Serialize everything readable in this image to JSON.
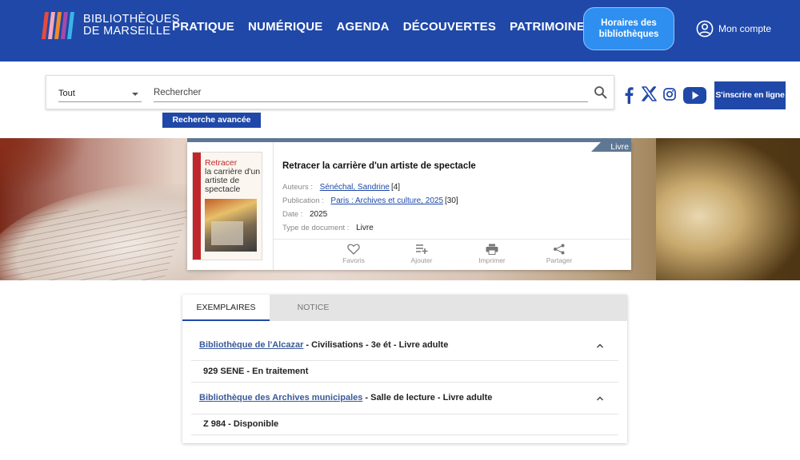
{
  "header": {
    "logo_line1": "BIBLIOTHÈQUES",
    "logo_line2": "DE MARSEILLE",
    "nav": [
      "PRATIQUE",
      "NUMÉRIQUE",
      "AGENDA",
      "DÉCOUVERTES",
      "PATRIMOINE"
    ],
    "hours_button": "Horaires des bibliothèques",
    "account_label": "Mon compte",
    "colors": {
      "brand": "#1f48a8",
      "accent": "#2e8ff0"
    }
  },
  "search": {
    "scope_value": "Tout",
    "placeholder": "Rechercher",
    "advanced_label": "Recherche avancée",
    "social_icons": [
      "facebook-icon",
      "x-icon",
      "instagram-icon",
      "youtube-icon"
    ],
    "signup_label": "S'inscrire en ligne"
  },
  "record": {
    "type_badge": "Livre",
    "cover_title_first": "Retracer",
    "cover_title_rest": "la carrière d'un artiste de spectacle",
    "title": "Retracer la carrière d'un artiste de spectacle",
    "authors_label": "Auteurs :",
    "authors_value": "Sénéchal, Sandrine",
    "authors_count": "[4]",
    "publication_label": "Publication :",
    "publication_value": "Paris : Archives et culture, 2025",
    "publication_count": "[30]",
    "date_label": "Date :",
    "date_value": "2025",
    "doctype_label": "Type de document :",
    "doctype_value": "Livre",
    "actions": [
      "Favoris",
      "Ajouter",
      "Imprimer",
      "Partager"
    ]
  },
  "copies": {
    "tabs": [
      "EXEMPLAIRES",
      "NOTICE"
    ],
    "items": [
      {
        "library": "Bibliothèque de l'Alcazar",
        "location": " - Civilisations - 3e ét - Livre adulte",
        "holding": "929 SENE - En traitement"
      },
      {
        "library": "Bibliothèque des Archives municipales",
        "location": " - Salle de lecture - Livre adulte",
        "holding": "Z 984 - Disponible"
      }
    ]
  }
}
